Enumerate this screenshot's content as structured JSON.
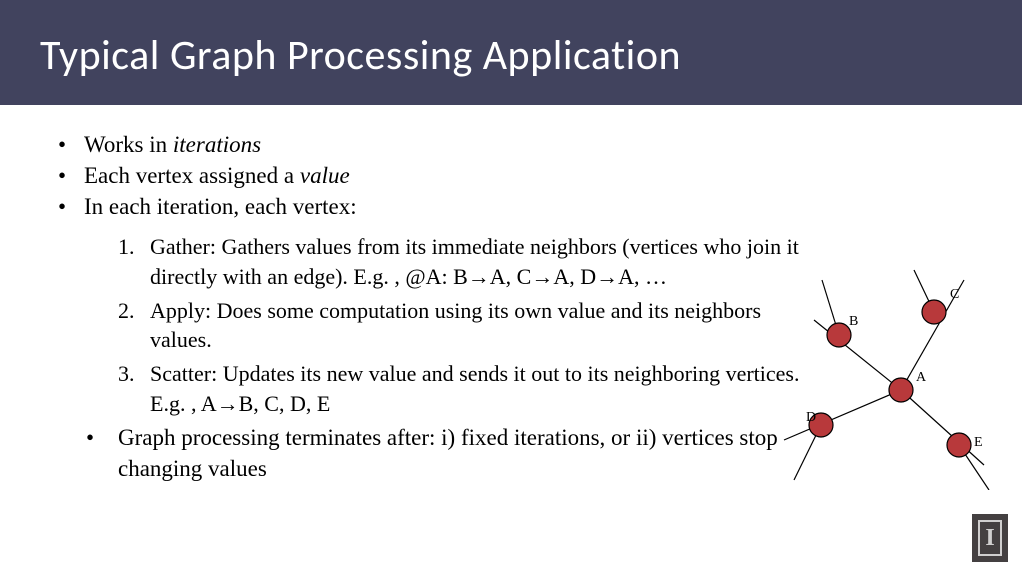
{
  "title": "Typical Graph Processing Application",
  "bullets": {
    "b1_pre": "Works in ",
    "b1_em": "iterations",
    "b2_pre": "Each vertex assigned a ",
    "b2_em": "value",
    "b3": "In each iteration, each vertex:"
  },
  "steps": {
    "n1": "1.",
    "s1": "Gather: Gathers values from its immediate neighbors (vertices who join it directly with an edge). E.g. , @A: B→A, C→A, D→A, …",
    "n2": "2.",
    "s2": "Apply: Does some computation using its own value and its neighbors values.",
    "n3": "3.",
    "s3": "Scatter: Updates its new value and sends it out to its neighboring vertices. E.g. , A→B, C, D, E"
  },
  "final": "Graph processing terminates after: i) fixed iterations, or ii) vertices stop changing values",
  "graph": {
    "labels": {
      "A": "A",
      "B": "B",
      "C": "C",
      "D": "D",
      "E": "E"
    }
  },
  "logo_letter": "I"
}
